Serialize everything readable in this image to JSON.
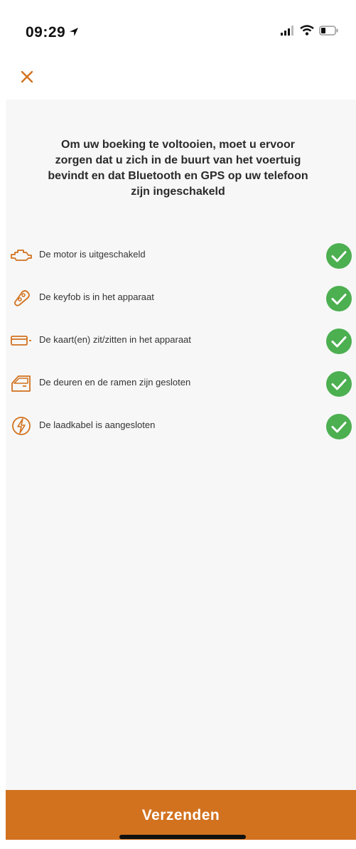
{
  "status_bar": {
    "time": "09:29"
  },
  "nav": {
    "close_icon": "close-icon"
  },
  "intro": {
    "text": "Om uw boeking te voltooien, moet u ervoor zorgen dat u zich in de buurt van het voertuig bevindt en dat Bluetooth en GPS op uw telefoon zijn ingeschakeld"
  },
  "checklist": [
    {
      "icon": "engine-icon",
      "label": "De motor is uitgeschakeld",
      "checked": true
    },
    {
      "icon": "keyfob-icon",
      "label": "De keyfob is in het apparaat",
      "checked": true
    },
    {
      "icon": "card-icon",
      "label": "De kaart(en) zit/zitten in het apparaat",
      "checked": true
    },
    {
      "icon": "door-icon",
      "label": "De deuren en de ramen zijn gesloten",
      "checked": true
    },
    {
      "icon": "charging-icon",
      "label": "De laadkabel is aangesloten",
      "checked": true
    }
  ],
  "submit": {
    "label": "Verzenden"
  },
  "colors": {
    "accent": "#d2721f",
    "check_green": "#4caf50",
    "background": "#f7f7f7"
  }
}
